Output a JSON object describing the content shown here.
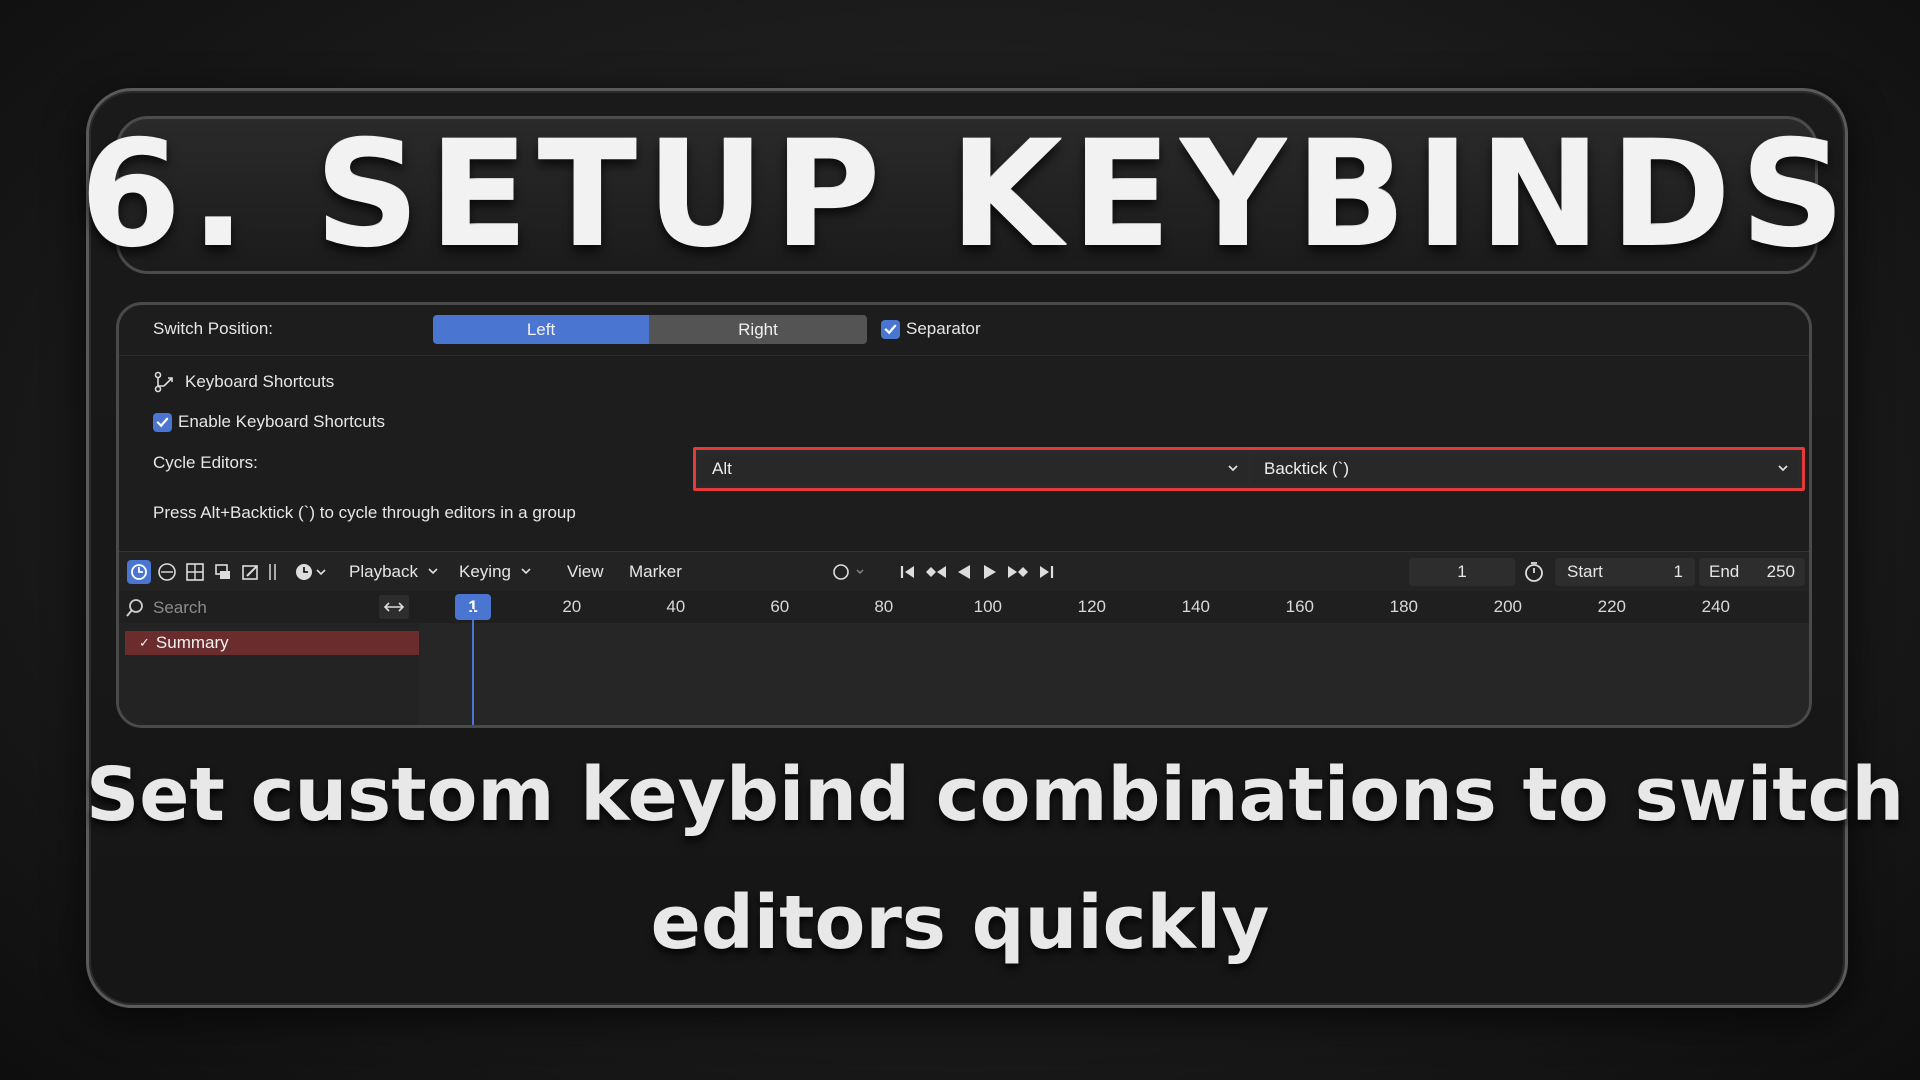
{
  "title": "6. SETUP KEYBINDS",
  "settings": {
    "switch_position_label": "Switch Position:",
    "switch_left": "Left",
    "switch_right": "Right",
    "separator_label": "Separator",
    "separator_checked": true,
    "keyboard_shortcuts_label": "Keyboard Shortcuts",
    "enable_shortcuts_label": "Enable Keyboard Shortcuts",
    "enable_shortcuts_checked": true,
    "cycle_editors_label": "Cycle Editors:",
    "modifier_value": "Alt",
    "key_value": "Backtick (`)",
    "hint": "Press Alt+Backtick (`) to cycle through editors in a group"
  },
  "timeline": {
    "menus": [
      "Playback",
      "Keying",
      "View",
      "Marker"
    ],
    "current_frame": "1",
    "start_label": "Start",
    "start_value": "1",
    "end_label": "End",
    "end_value": "250",
    "search_placeholder": "Search",
    "summary_label": "Summary",
    "playhead_frame": "1",
    "ticks": [
      "20",
      "40",
      "60",
      "80",
      "100",
      "120",
      "140",
      "160",
      "180",
      "200",
      "220",
      "240"
    ]
  },
  "caption": {
    "line1": "Set custom keybind combinations to switch",
    "line2": "editors quickly"
  },
  "colors": {
    "accent": "#4a76d1",
    "highlight_border": "#e43a3a",
    "summary_bg": "#6b2c2e"
  }
}
